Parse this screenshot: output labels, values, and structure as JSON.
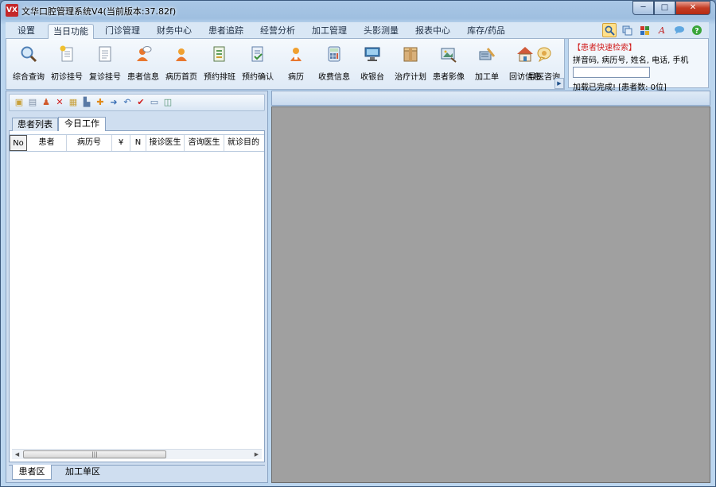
{
  "window": {
    "icon_text": "VX",
    "title": "文华口腔管理系统V4(当前版本:37.82f)",
    "buttons": {
      "minimize": "─",
      "maximize": "□",
      "close": "✕"
    }
  },
  "menu": {
    "tabs": [
      {
        "label": "设置",
        "active": false
      },
      {
        "label": "当日功能",
        "active": true
      },
      {
        "label": "门诊管理",
        "active": false
      },
      {
        "label": "财务中心",
        "active": false
      },
      {
        "label": "患者追踪",
        "active": false
      },
      {
        "label": "经营分析",
        "active": false
      },
      {
        "label": "加工管理",
        "active": false
      },
      {
        "label": "头影测量",
        "active": false
      },
      {
        "label": "报表中心",
        "active": false
      },
      {
        "label": "库存/药品",
        "active": false
      }
    ],
    "right_icons": [
      "search-icon",
      "refresh-icon",
      "grid-icon",
      "font-icon",
      "chat-icon",
      "help-icon"
    ]
  },
  "ribbon": {
    "items": [
      {
        "label": "综合查询",
        "icon": "magnifier-icon",
        "color": "#6fa8dc"
      },
      {
        "label": "初诊挂号",
        "icon": "new-document-icon",
        "color": "#e8b93b"
      },
      {
        "label": "复诊挂号",
        "icon": "document-icon",
        "color": "#cfd8e3"
      },
      {
        "label": "患者信息",
        "icon": "patient-info-icon",
        "color": "#e8772e"
      },
      {
        "label": "病历首页",
        "icon": "medical-record-icon",
        "color": "#e8772e"
      },
      {
        "label": "预约排班",
        "icon": "schedule-icon",
        "color": "#5f9e5a"
      },
      {
        "label": "预约确认",
        "icon": "confirm-icon",
        "color": "#5f7ea8"
      },
      {
        "label": "病历",
        "icon": "doctor-icon",
        "color": "#e8772e"
      },
      {
        "label": "收费信息",
        "icon": "calculator-icon",
        "color": "#7fa9c9"
      },
      {
        "label": "收银台",
        "icon": "cashier-icon",
        "color": "#3f7fb5"
      },
      {
        "label": "治疗计划",
        "icon": "box-icon",
        "color": "#c89a5e"
      },
      {
        "label": "患者影像",
        "icon": "image-icon",
        "color": "#4f8f6f"
      },
      {
        "label": "加工单",
        "icon": "tools-icon",
        "color": "#d8a24a"
      },
      {
        "label": "回访信息",
        "icon": "house-icon",
        "color": "#d05a3a"
      },
      {
        "label": "导医咨询",
        "icon": "bubble-icon",
        "color": "#e0a84a"
      }
    ],
    "more_arrow": "▶"
  },
  "search_panel": {
    "title": "【患者快速检索】",
    "hint": "拼音码, 病历号, 姓名, 电话, 手机",
    "input_value": "",
    "status": "加载已完成! [患者数: 0位]"
  },
  "left_panel": {
    "toolbar_icons": [
      {
        "name": "add-icon",
        "glyph": "▣",
        "color": "#c8a03a"
      },
      {
        "name": "copy-icon",
        "glyph": "▤",
        "color": "#7f8fa6"
      },
      {
        "name": "users-icon",
        "glyph": "♟",
        "color": "#d0582a"
      },
      {
        "name": "delete-icon",
        "glyph": "✕",
        "color": "#d01f1f"
      },
      {
        "name": "clipboard-icon",
        "glyph": "▦",
        "color": "#c8a03a"
      },
      {
        "name": "tree-icon",
        "glyph": "▙",
        "color": "#5a7aa6"
      },
      {
        "name": "insert-icon",
        "glyph": "✚",
        "color": "#e08a1a"
      },
      {
        "name": "move-right-icon",
        "glyph": "➜",
        "color": "#3a6fb5"
      },
      {
        "name": "undo-icon",
        "glyph": "↶",
        "color": "#3a6fb5"
      },
      {
        "name": "check-icon",
        "glyph": "✔",
        "color": "#d01f1f"
      },
      {
        "name": "window-icon",
        "glyph": "▭",
        "color": "#5a7aa6"
      },
      {
        "name": "export-icon",
        "glyph": "◫",
        "color": "#4f8f6f"
      }
    ],
    "tabs": [
      {
        "label": "患者列表",
        "active": false
      },
      {
        "label": "今日工作",
        "active": true
      }
    ],
    "columns": [
      "No",
      "患者",
      "病历号",
      "¥",
      "N",
      "接诊医生",
      "咨询医生",
      "就诊目的"
    ],
    "rows": [],
    "scroll_thumb_glyph": "|||",
    "bottom_tabs": [
      {
        "label": "患者区",
        "active": true
      },
      {
        "label": "加工单区",
        "active": false
      }
    ]
  }
}
